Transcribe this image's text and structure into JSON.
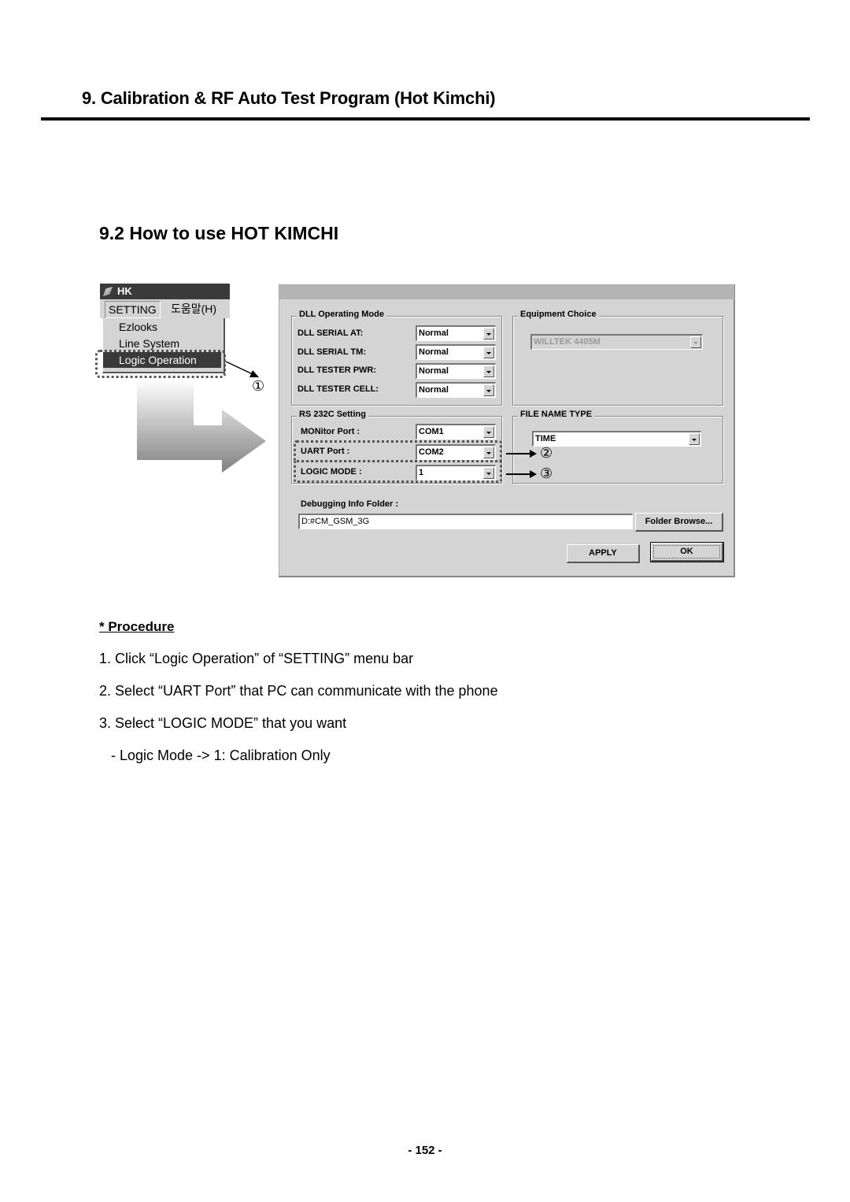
{
  "chapter_title": "9. Calibration & RF Auto Test Program (Hot Kimchi)",
  "section_title": "9.2 How to use HOT KIMCHI",
  "menu_screenshot": {
    "app_title": "HK",
    "menubar": [
      {
        "label": "SETTING",
        "active": true
      },
      {
        "label": "도움말(H)",
        "active": false
      }
    ],
    "dropdown_items": [
      {
        "label": "Ezlooks",
        "selected": false
      },
      {
        "label": "Line System",
        "selected": false
      },
      {
        "label": "Logic Operation",
        "selected": true
      }
    ]
  },
  "callouts": [
    "①",
    "②",
    "③"
  ],
  "dialog": {
    "dll_group": {
      "title": "DLL Operating Mode",
      "rows": [
        {
          "label": "DLL SERIAL AT:",
          "value": "Normal"
        },
        {
          "label": "DLL SERIAL TM:",
          "value": "Normal"
        },
        {
          "label": "DLL TESTER PWR:",
          "value": "Normal"
        },
        {
          "label": "DLL TESTER CELL:",
          "value": "Normal"
        }
      ]
    },
    "equipment_group": {
      "title": "Equipment Choice",
      "value": "WILLTEK 4405M",
      "disabled": true
    },
    "rs232_group": {
      "title": "RS 232C Setting",
      "rows": [
        {
          "label": "MONitor Port :",
          "value": "COM1"
        },
        {
          "label": "UART Port :",
          "value": "COM2"
        },
        {
          "label": "LOGIC MODE :",
          "value": "1"
        }
      ]
    },
    "filename_group": {
      "title": "FILE NAME TYPE",
      "value": "TIME"
    },
    "debug_folder": {
      "label": "Debugging Info Folder :",
      "value": "D:#CM_GSM_3G",
      "browse_label": "Folder Browse..."
    },
    "apply_label": "APPLY",
    "ok_label": "OK"
  },
  "procedure": {
    "heading": "* Procedure",
    "steps": [
      "1. Click “Logic Operation” of “SETTING” menu bar",
      "2. Select “UART Port” that PC can communicate with the phone",
      "3. Select “LOGIC MODE” that you want",
      "   - Logic Mode -> 1: Calibration Only"
    ]
  },
  "page_number": "- 152 -"
}
